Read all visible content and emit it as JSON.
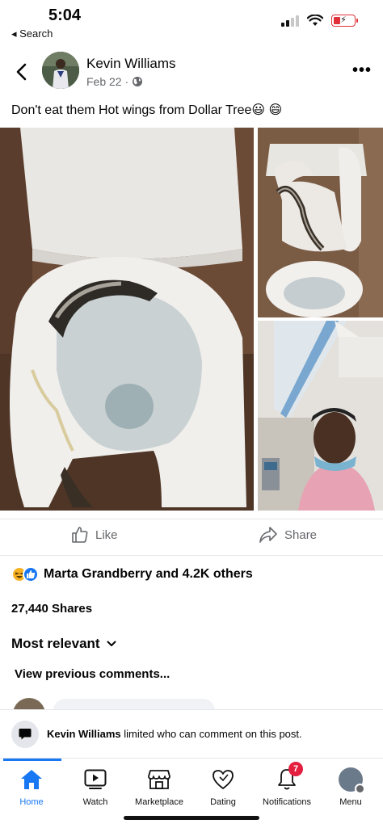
{
  "status_bar": {
    "time": "5:04",
    "back_label": "◂ Search"
  },
  "post": {
    "author": "Kevin Williams",
    "date": "Feb 22 ·",
    "privacy_icon": "globe-icon",
    "text": "Don't eat them Hot wings from Dollar Tree😃 😄"
  },
  "actions": {
    "like_label": "Like",
    "share_label": "Share"
  },
  "reactions": {
    "summary": "Marta Grandberry and 4.2K others",
    "icons": [
      "haha-reaction-icon",
      "like-reaction-icon"
    ]
  },
  "shares_text": "27,440 Shares",
  "comments": {
    "sort_label": "Most relevant",
    "view_previous": "View previous comments..."
  },
  "limit_notice": {
    "name": "Kevin Williams",
    "message": " limited who can comment on this post."
  },
  "tab_bar": {
    "tabs": [
      {
        "label": "Home",
        "icon": "home-icon",
        "active": true
      },
      {
        "label": "Watch",
        "icon": "watch-icon"
      },
      {
        "label": "Marketplace",
        "icon": "marketplace-icon"
      },
      {
        "label": "Dating",
        "icon": "dating-heart-icon"
      },
      {
        "label": "Notifications",
        "icon": "bell-icon",
        "badge": "7"
      },
      {
        "label": "Menu",
        "icon": "profile-avatar-icon"
      }
    ]
  },
  "colors": {
    "accent": "#1877f2",
    "badge": "#e41e3f",
    "battery_low": "#e0303a",
    "secondary_text": "#65676b"
  }
}
